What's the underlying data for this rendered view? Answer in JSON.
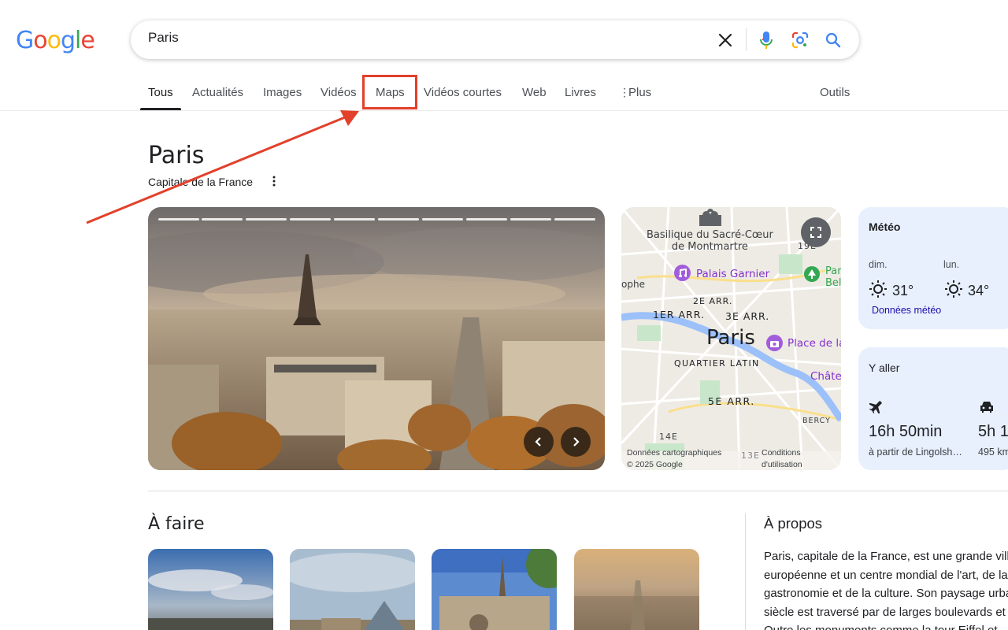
{
  "logo": {
    "letters": [
      "G",
      "o",
      "o",
      "g",
      "l",
      "e"
    ],
    "colors": [
      "#4285f4",
      "#ea4335",
      "#fbbc05",
      "#4285f4",
      "#34a853",
      "#ea4335"
    ]
  },
  "search": {
    "value": "Paris",
    "clear_icon": "close-icon",
    "voice_icon": "mic-icon",
    "lens_icon": "lens-icon",
    "search_icon": "search-icon"
  },
  "tabs": [
    {
      "label": "Tous",
      "active": true
    },
    {
      "label": "Actualités"
    },
    {
      "label": "Images"
    },
    {
      "label": "Vidéos"
    },
    {
      "label": "Maps",
      "highlighted": true
    },
    {
      "label": "Vidéos courtes"
    },
    {
      "label": "Web"
    },
    {
      "label": "Livres"
    },
    {
      "label": "Plus"
    }
  ],
  "tools_label": "Outils",
  "entity": {
    "title": "Paris",
    "subtitle": "Capitale de la France"
  },
  "map": {
    "labels": {
      "sacre_coeur": "Basilique du Sacré-Cœur\nde Montmartre",
      "palais_garnier": "Palais Garnier",
      "arr2": "2E ARR.",
      "arr1": "1ER ARR.",
      "arr3": "3E ARR.",
      "city": "Paris",
      "place": "Place de la",
      "latin": "QUARTIER LATIN",
      "arr5": "5E ARR.",
      "arr14": "14E",
      "arr13": "13E",
      "arr19": "19E",
      "bercy": "BERCY",
      "chate": "Châte",
      "par": "Par",
      "bel": "Bel",
      "ophe": "ophe"
    },
    "footer_left": "Données cartographiques\n© 2025 Google",
    "footer_right": "Conditions\nd'utilisation"
  },
  "weather": {
    "title": "Météo",
    "days": [
      {
        "day": "dim.",
        "temp": "31°"
      },
      {
        "day": "lun.",
        "temp": "34°"
      }
    ],
    "link": "Données météo"
  },
  "travel": {
    "title": "Y aller",
    "flight_time": "16h 50min",
    "flight_from": "à partir de Lingolsh…",
    "car_time": "5h 1",
    "car_dist": "495 km"
  },
  "sections": {
    "todo": "À faire",
    "about": "À propos"
  },
  "about_lines": [
    "Paris, capitale de la France, est une grande vill",
    "européenne et un centre mondial de l'art, de la",
    "gastronomie et de la culture. Son paysage urba",
    "siècle est traversé par de larges boulevards et",
    "Outre les monuments comme la tour Eiffel et"
  ],
  "colors": {
    "highlight": "#e2402a",
    "accent_blue": "#1a0dab",
    "card_bg": "#e8f0fe"
  }
}
